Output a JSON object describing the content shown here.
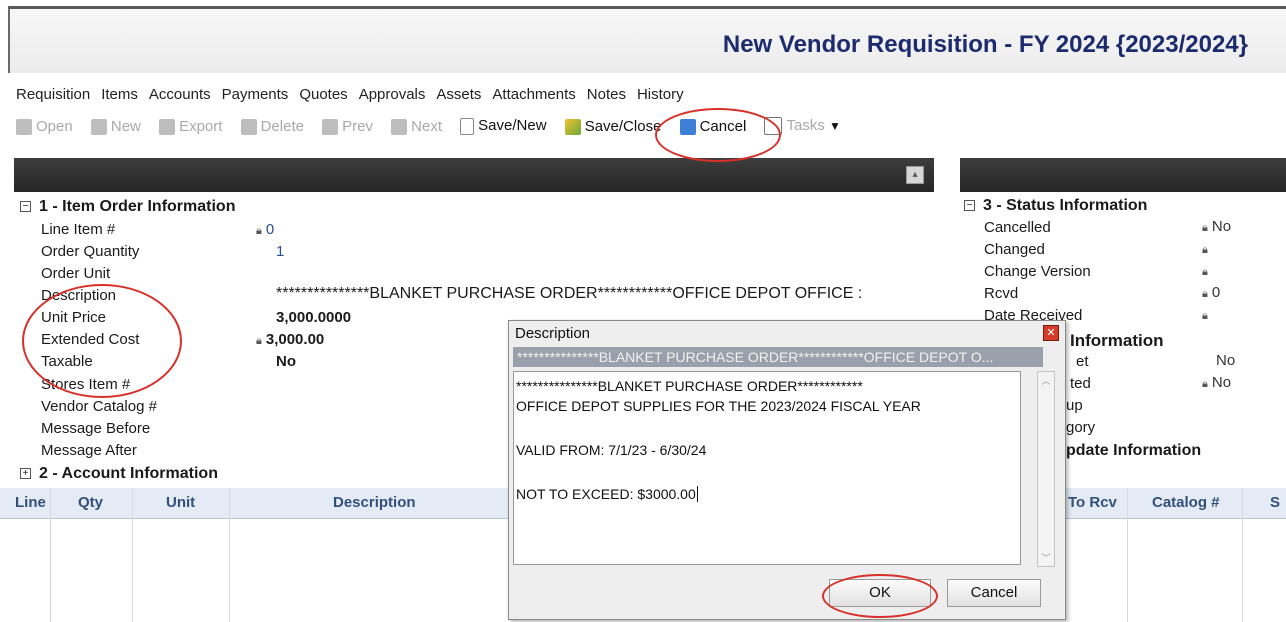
{
  "window": {
    "title": "New Vendor Requisition - FY 2024 {2023/2024}"
  },
  "tabs": [
    "Requisition",
    "Items",
    "Accounts",
    "Payments",
    "Quotes",
    "Approvals",
    "Assets",
    "Attachments",
    "Notes",
    "History"
  ],
  "toolbar": {
    "open": "Open",
    "new": "New",
    "export": "Export",
    "delete": "Delete",
    "prev": "Prev",
    "next": "Next",
    "save_new": "Save/New",
    "save_close": "Save/Close",
    "cancel": "Cancel",
    "tasks": "Tasks"
  },
  "sections": {
    "item_order": {
      "header": "1 - Item Order Information",
      "fields": [
        {
          "label": "Line Item #",
          "value": "0"
        },
        {
          "label": "Order Quantity",
          "value": "1"
        },
        {
          "label": "Order Unit",
          "value": ""
        },
        {
          "label": "Description",
          "value": "***************BLANKET PURCHASE ORDER************OFFICE DEPOT OFFICE :"
        },
        {
          "label": "Unit Price",
          "value": "3,000.0000"
        },
        {
          "label": "Extended Cost",
          "value": "3,000.00"
        },
        {
          "label": "Taxable",
          "value": "No"
        },
        {
          "label": "Stores Item #",
          "value": ""
        },
        {
          "label": "Vendor Catalog #",
          "value": ""
        },
        {
          "label": "Message Before",
          "value": ""
        },
        {
          "label": "Message After",
          "value": ""
        }
      ]
    },
    "account": {
      "header": "2 - Account Information"
    },
    "status": {
      "header": "3 - Status Information",
      "fields": [
        {
          "label": "Cancelled",
          "value": "No"
        },
        {
          "label": "Changed",
          "value": ""
        },
        {
          "label": "Change Version",
          "value": ""
        },
        {
          "label": "Rcvd",
          "value": "0"
        },
        {
          "label": "Date Received",
          "value": ""
        }
      ],
      "partial_header": "Information",
      "partial_fields": [
        {
          "label": "et",
          "value": "No"
        },
        {
          "label": "ted",
          "value": "No"
        },
        {
          "label": "up",
          "value": ""
        },
        {
          "label": "gory",
          "value": ""
        }
      ],
      "partial_header2": "pdate Information"
    }
  },
  "grid": {
    "columns": [
      "Line",
      "Qty",
      "Unit",
      "Description",
      "To Rcv",
      "Catalog #",
      "S"
    ]
  },
  "dialog": {
    "title": "Description",
    "close": "✕",
    "strip": "***************BLANKET PURCHASE ORDER************OFFICE DEPOT O...",
    "lines": [
      "***************BLANKET PURCHASE ORDER************",
      "OFFICE DEPOT SUPPLIES FOR THE 2023/2024 FISCAL YEAR",
      "",
      "VALID FROM: 7/1/23 - 6/30/24",
      "",
      "NOT TO EXCEED: $3000.00"
    ],
    "ok": "OK",
    "cancel": "Cancel"
  },
  "colors": {
    "title": "#1c2a6e",
    "annotation": "#d8302a",
    "header_bar": "#2c2c2c"
  }
}
